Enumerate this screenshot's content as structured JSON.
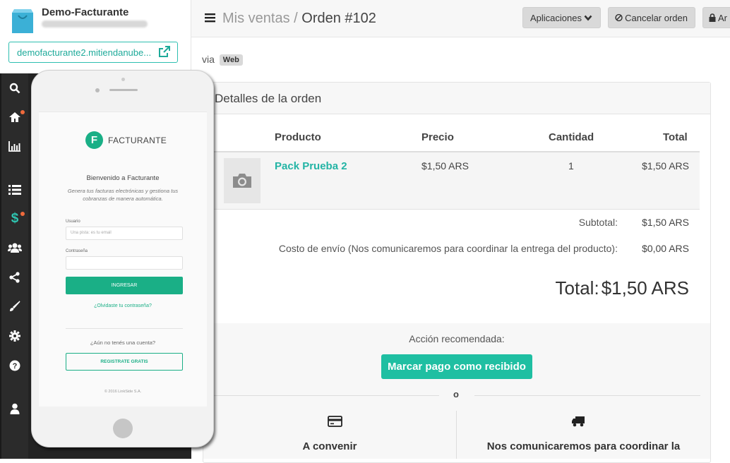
{
  "brand": {
    "store_name": "Demo-Facturante",
    "store_link": "demofacturante2.mitiendanube..."
  },
  "sidebar": {
    "items": [
      {
        "icon": "search-icon"
      },
      {
        "icon": "home-icon",
        "dot": true
      },
      {
        "icon": "stats-icon"
      },
      {
        "icon": "list-icon"
      },
      {
        "icon": "dollar-icon",
        "dot": true
      },
      {
        "icon": "users-icon"
      },
      {
        "icon": "share-icon"
      },
      {
        "icon": "brush-icon"
      },
      {
        "icon": "gear-icon"
      },
      {
        "icon": "help-icon"
      },
      {
        "icon": "user-icon"
      }
    ]
  },
  "header": {
    "crumb_parent": "Mis ventas",
    "crumb_sep": " / ",
    "crumb_current": "Orden #102",
    "apps_label": "Aplicaciones",
    "cancel_label": "Cancelar orden",
    "archive_label": "Ar"
  },
  "via": {
    "label": "via",
    "badge": "Web"
  },
  "order": {
    "panel_title": "Detalles de la orden",
    "columns": {
      "product": "Producto",
      "price": "Precio",
      "qty": "Cantidad",
      "total": "Total"
    },
    "items": [
      {
        "name": "Pack Prueba 2",
        "price": "$1,50 ARS",
        "qty": "1",
        "total": "$1,50 ARS"
      }
    ],
    "subtotal_label": "Subtotal:",
    "subtotal_value": "$1,50 ARS",
    "shipping_label": "Costo de envío (Nos comunicaremos para coordinar la entrega del producto):",
    "shipping_value": "$0,00 ARS",
    "total_label": "Total:",
    "total_value": "$1,50 ARS"
  },
  "action": {
    "label": "Acción recomendada:",
    "button": "Marcar pago como recibido",
    "separator": "o",
    "payment_method": "A convenir",
    "shipping_method": "Nos comunicaremos para coordinar la"
  },
  "phone": {
    "logo_letter": "F",
    "logo_text": "FACTURANTE",
    "welcome": "Bienvenido a Facturante",
    "subtitle": "Genera tus facturas electrónicas y gestiona tus cobranzas de manera automática.",
    "user_label": "Usuario",
    "user_placeholder": "Una pista: es tu email",
    "password_label": "Contraseña",
    "login_button": "INGRESAR",
    "forgot_link": "¿Olvidaste tu contraseña?",
    "no_account": "¿Aún no tenés una cuenta?",
    "register_button": "REGISTRATE GRATIS",
    "copyright": "© 2016 LinkSide S.A."
  }
}
